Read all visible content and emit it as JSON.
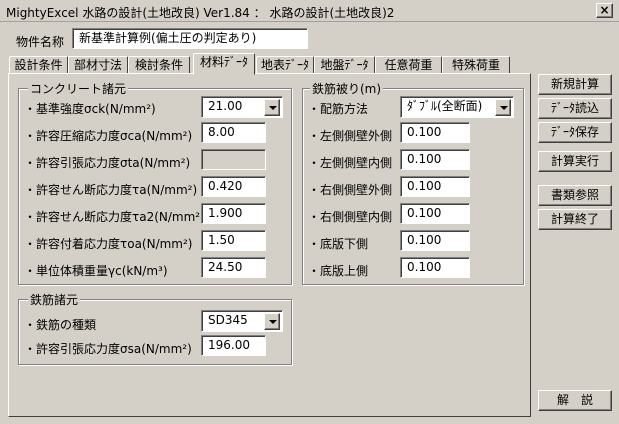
{
  "window": {
    "title": "MightyExcel 水路の設計(土地改良) Ver1.84 ： 水路の設計(土地改良)2",
    "close_label": "×"
  },
  "project": {
    "label": "物件名称",
    "value": "新基準計算例(偏土圧の判定あり)"
  },
  "tabs": [
    {
      "label": "設計条件"
    },
    {
      "label": "部材寸法"
    },
    {
      "label": "検討条件"
    },
    {
      "label": "材料ﾃﾞｰﾀ"
    },
    {
      "label": "地表ﾃﾞｰﾀ"
    },
    {
      "label": "地盤ﾃﾞｰﾀ"
    },
    {
      "label": "任意荷重"
    },
    {
      "label": "特殊荷重"
    }
  ],
  "concrete": {
    "title": "コンクリート諸元",
    "rows": [
      {
        "label": "・基準強度σck(N/mm²)",
        "value": "21.00"
      },
      {
        "label": "・許容圧縮応力度σca(N/mm²)",
        "value": "8.00"
      },
      {
        "label": "・許容引張応力度σta(N/mm²)",
        "value": ""
      },
      {
        "label": "・許容せん断応力度τa(N/mm²)",
        "value": "0.420"
      },
      {
        "label": "・許容せん断応力度τa2(N/mm²)",
        "value": "1.900"
      },
      {
        "label": "・許容付着応力度τoa(N/mm²)",
        "value": "1.50"
      },
      {
        "label": "・単位体積重量γc(kN/m³)",
        "value": "24.50"
      }
    ]
  },
  "rebar": {
    "title": "鉄筋諸元",
    "rows": [
      {
        "label": "・鉄筋の種類",
        "value": "SD345"
      },
      {
        "label": "・許容引張応力度σsa(N/mm²)",
        "value": "196.00"
      }
    ]
  },
  "cover": {
    "title": "鉄筋被り(m)",
    "rows": [
      {
        "label": "・配筋方法",
        "value": "ﾀﾞﾌﾞﾙ(全断面)"
      },
      {
        "label": "・左側側壁外側",
        "value": "0.100"
      },
      {
        "label": "・左側側壁内側",
        "value": "0.100"
      },
      {
        "label": "・右側側壁外側",
        "value": "0.100"
      },
      {
        "label": "・右側側壁内側",
        "value": "0.100"
      },
      {
        "label": "・底版下側",
        "value": "0.100"
      },
      {
        "label": "・底版上側",
        "value": "0.100"
      }
    ]
  },
  "buttons": {
    "new_calc": "新規計算",
    "load_data": "ﾃﾞｰﾀ読込",
    "save_data": "ﾃﾞｰﾀ保存",
    "run_calc": "計算実行",
    "view_docs": "書類参照",
    "end_calc": "計算終了",
    "help": "解　説"
  }
}
